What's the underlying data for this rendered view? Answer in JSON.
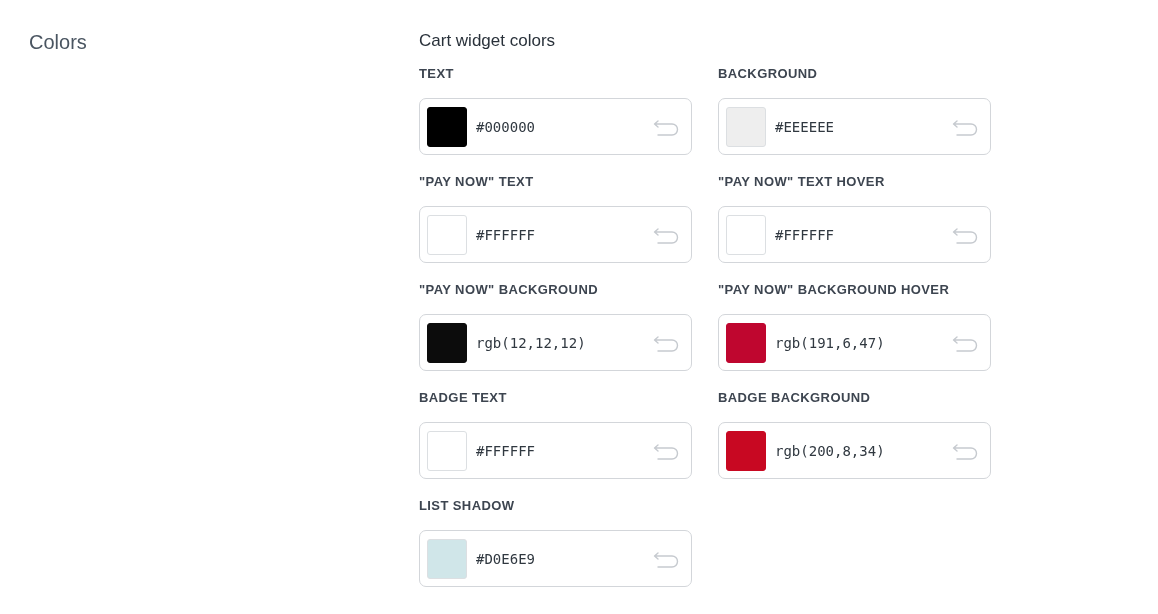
{
  "section": {
    "title": "Colors"
  },
  "group": {
    "title": "Cart widget colors"
  },
  "fields": [
    {
      "label": "TEXT",
      "value": "#000000",
      "color": "#000000"
    },
    {
      "label": "BACKGROUND",
      "value": "#EEEEEE",
      "color": "#eeeeee"
    },
    {
      "label": "\"PAY NOW\" TEXT",
      "value": "#FFFFFF",
      "color": "#ffffff"
    },
    {
      "label": "\"PAY NOW\" TEXT HOVER",
      "value": "#FFFFFF",
      "color": "#ffffff"
    },
    {
      "label": "\"PAY NOW\" BACKGROUND",
      "value": "rgb(12,12,12)",
      "color": "#0c0c0c"
    },
    {
      "label": "\"PAY NOW\" BACKGROUND HOVER",
      "value": "rgb(191,6,47)",
      "color": "#bf062f"
    },
    {
      "label": "BADGE TEXT",
      "value": "#FFFFFF",
      "color": "#ffffff"
    },
    {
      "label": "BADGE BACKGROUND",
      "value": "rgb(200,8,34)",
      "color": "#c80822"
    },
    {
      "label": "LIST SHADOW",
      "value": "#D0E6E9",
      "color": "#d0e6e9"
    }
  ]
}
